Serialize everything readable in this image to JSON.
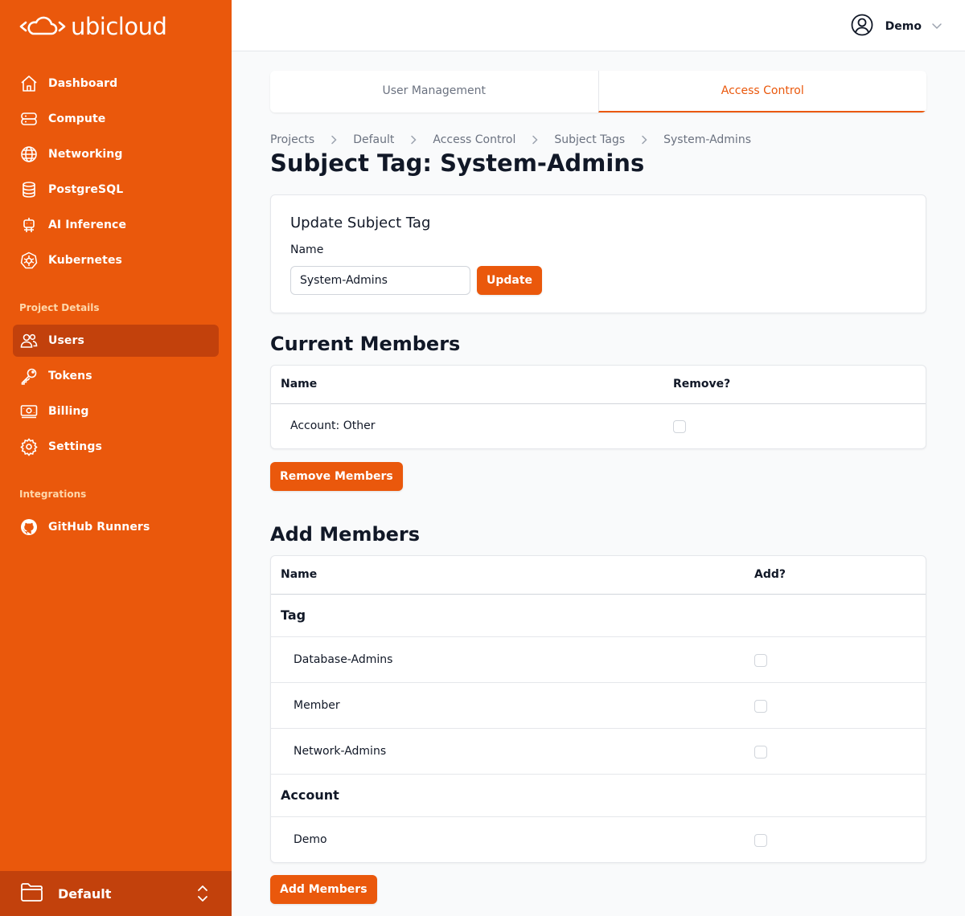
{
  "app": {
    "brand": "ubicloud",
    "accent": "#ea580c",
    "accent_dark": "#c2410c"
  },
  "sidebar": {
    "main_nav": [
      {
        "label": "Dashboard",
        "icon": "home-icon"
      },
      {
        "label": "Compute",
        "icon": "server-icon"
      },
      {
        "label": "Networking",
        "icon": "globe-icon"
      },
      {
        "label": "PostgreSQL",
        "icon": "database-icon"
      },
      {
        "label": "AI Inference",
        "icon": "robot-icon"
      },
      {
        "label": "Kubernetes",
        "icon": "kubernetes-icon"
      }
    ],
    "project_details_heading": "Project Details",
    "project_nav": [
      {
        "label": "Users",
        "icon": "users-icon",
        "active": true
      },
      {
        "label": "Tokens",
        "icon": "key-icon"
      },
      {
        "label": "Billing",
        "icon": "billing-icon"
      },
      {
        "label": "Settings",
        "icon": "gear-icon"
      }
    ],
    "integrations_heading": "Integrations",
    "integrations_nav": [
      {
        "label": "GitHub Runners",
        "icon": "github-icon"
      }
    ],
    "project_switcher": {
      "label": "Default",
      "icon": "folder-icon"
    }
  },
  "topbar": {
    "user_name": "Demo"
  },
  "tabs": [
    {
      "label": "User Management",
      "active": false
    },
    {
      "label": "Access Control",
      "active": true
    }
  ],
  "breadcrumb": [
    "Projects",
    "Default",
    "Access Control",
    "Subject Tags",
    "System-Admins"
  ],
  "page_title": "Subject Tag: System-Admins",
  "update_form": {
    "title": "Update Subject Tag",
    "name_label": "Name",
    "name_value": "System-Admins",
    "submit_label": "Update"
  },
  "current_members": {
    "title": "Current Members",
    "columns": [
      "Name",
      "Remove?"
    ],
    "rows": [
      {
        "name": "Account: Other",
        "checked": false
      }
    ],
    "submit_label": "Remove Members"
  },
  "add_members": {
    "title": "Add Members",
    "columns": [
      "Name",
      "Add?"
    ],
    "groups": [
      {
        "label": "Tag",
        "rows": [
          {
            "name": "Database-Admins",
            "checked": false
          },
          {
            "name": "Member",
            "checked": false
          },
          {
            "name": "Network-Admins",
            "checked": false
          }
        ]
      },
      {
        "label": "Account",
        "rows": [
          {
            "name": "Demo",
            "checked": false
          }
        ]
      }
    ],
    "submit_label": "Add Members"
  }
}
